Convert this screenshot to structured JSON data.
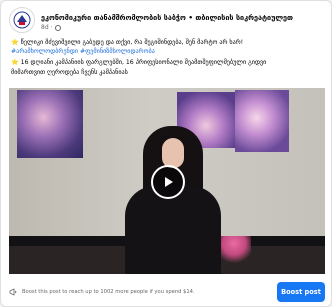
{
  "header": {
    "page_name": "ეკონომიკური თანამშრომლობის საბჭო • თბილისის სიკრეატიულეთ",
    "time": "8d",
    "visibility_icon": "globe-icon"
  },
  "caption": {
    "line1": "⭐ წელიკი მძევიშვილი გაბედე და თქვი, რა შეგიშინდება, შენ მარტო არ ხარ!",
    "hashtags": "#არამხოლოდბრენდი #ფემინიზმსოლიდარობა",
    "line3a": "⭐ 16 დღიანი კამპანიის ფარგლებში, 16 პრიფესიონალი შეამთშეფილმებული გიდვი",
    "line3b": "მიმართვით ღეროდება ჩვენს კამპანიას"
  },
  "video": {
    "play_icon": "play-icon"
  },
  "footer": {
    "boost_hint": "Boost this post to reach up to 1002 more people if you spend $14.",
    "boost_label": "Boost post"
  },
  "colors": {
    "accent": "#1877f2",
    "hashtag": "#216fdb",
    "muted": "#65676b"
  }
}
